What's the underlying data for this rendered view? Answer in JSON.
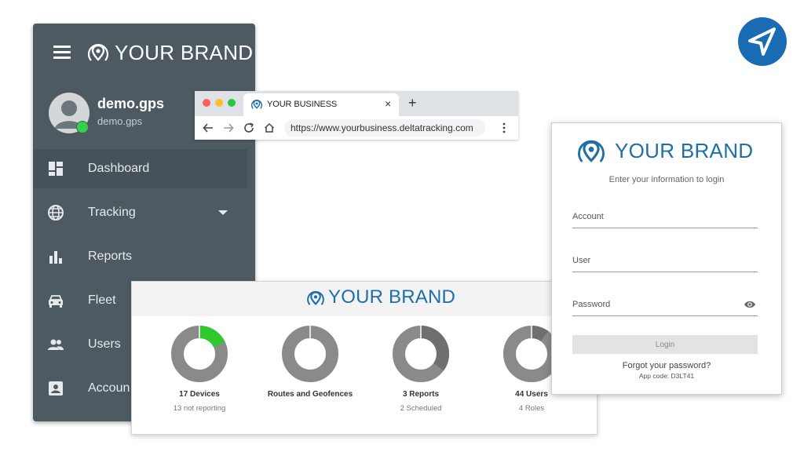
{
  "sidebar": {
    "brand": "YOUR BRAND",
    "user": {
      "name": "demo.gps",
      "sub": "demo.gps"
    },
    "nav": [
      {
        "label": "Dashboard",
        "icon": "dashboard-icon",
        "active": true
      },
      {
        "label": "Tracking",
        "icon": "globe-icon"
      },
      {
        "label": "Reports",
        "icon": "bar-chart-icon"
      },
      {
        "label": "Fleet",
        "icon": "car-icon"
      },
      {
        "label": "Users",
        "icon": "users-icon"
      },
      {
        "label": "Accoun",
        "icon": "account-box-icon"
      }
    ]
  },
  "browser": {
    "tab_title": "YOUR BUSINESS",
    "close": "×",
    "new_tab": "+",
    "url": "https://www.yourbusiness.deltatracking.com"
  },
  "dashboard": {
    "brand": "YOUR BRAND",
    "stats": [
      {
        "title": "17 Devices",
        "sub": "13 not reporting",
        "share": 0.18,
        "color": "#2ec92e"
      },
      {
        "title": "Routes and Geofences",
        "sub": "",
        "share": 0.0,
        "color": "#777777"
      },
      {
        "title": "3 Reports",
        "sub": "2 Scheduled",
        "share": 0.35,
        "color": "#6f6f6f"
      },
      {
        "title": "44 Users",
        "sub": "4 Roles",
        "share": 0.1,
        "color": "#6f6f6f"
      }
    ]
  },
  "login": {
    "brand": "YOUR BRAND",
    "subtitle": "Enter your information to login",
    "account_label": "Account",
    "user_label": "User",
    "password_label": "Password",
    "button": "Login",
    "forgot": "Forgot your password?",
    "app_code": "App code: D3LT41"
  },
  "colors": {
    "accent": "#1d6fa6",
    "sidebar": "#4d5a62",
    "online": "#32d14a"
  }
}
